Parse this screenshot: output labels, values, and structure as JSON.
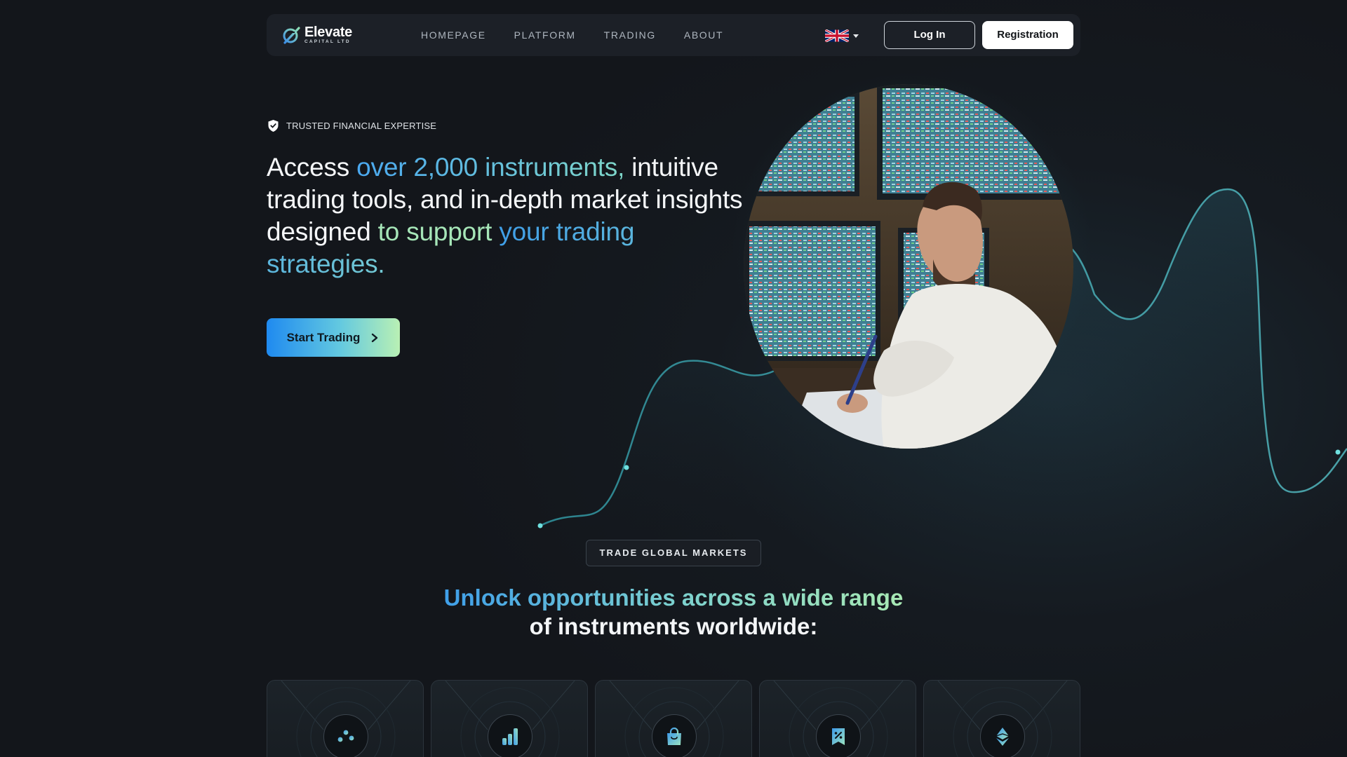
{
  "brand": {
    "name": "Elevate",
    "subtitle": "CAPITAL LTD"
  },
  "nav": {
    "links": [
      "HOMEPAGE",
      "PLATFORM",
      "TRADING",
      "ABOUT"
    ],
    "language_icon": "uk-flag-icon",
    "login_label": "Log In",
    "register_label": "Registration"
  },
  "hero": {
    "badge_text": "TRUSTED FINANCIAL EXPERTISE",
    "headline": {
      "p1": "Access ",
      "p2": "over 2,000 instruments,",
      "p3": " intuitive trading tools, and in-depth market insights designed ",
      "p4": "to support",
      "p5": " your trading strategies."
    },
    "cta_label": "Start Trading"
  },
  "markets": {
    "tag": "TRADE GLOBAL MARKETS",
    "title_highlight": "Unlock opportunities across a wide range",
    "title_rest": "of instruments worldwide:",
    "cards": [
      {
        "icon": "sliders-icon"
      },
      {
        "icon": "bar-chart-icon"
      },
      {
        "icon": "shopping-bag-icon"
      },
      {
        "icon": "percent-tag-icon"
      },
      {
        "icon": "ethereum-icon"
      }
    ]
  },
  "colors": {
    "accent_blue": "#1f8af0",
    "accent_green": "#b9f0b4",
    "background": "#14171c"
  }
}
